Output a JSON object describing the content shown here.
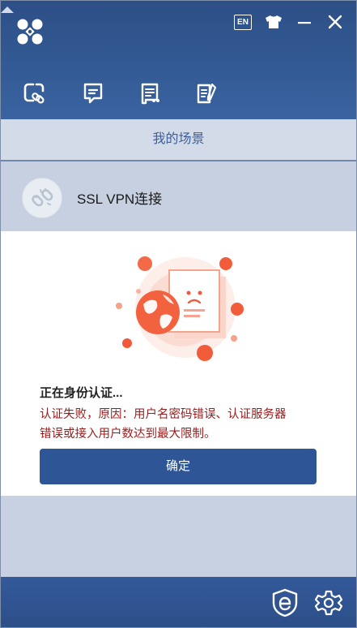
{
  "colors": {
    "header": "#2d4f86",
    "accent": "#2e5596",
    "error": "#9a1c1c",
    "tab_text": "#3e5f98"
  },
  "header": {
    "icons": [
      "app-logo-icon",
      "language-en-icon",
      "skin-shirt-icon",
      "minimize-icon",
      "close-icon"
    ],
    "language_badge": "EN"
  },
  "nav": {
    "tabs": [
      {
        "id": "scenes",
        "icon": "link-scene-icon",
        "active": true
      },
      {
        "id": "messages",
        "icon": "message-icon",
        "active": false
      },
      {
        "id": "logs",
        "icon": "log-list-icon",
        "active": false
      },
      {
        "id": "notes",
        "icon": "notes-icon",
        "active": false
      }
    ]
  },
  "section": {
    "title": "我的场景"
  },
  "scene": {
    "label": "SSL VPN连接"
  },
  "dialog": {
    "status": "正在身份认证...",
    "error_line1": "认证失败，原因：用户名密码错误、认证服务器",
    "error_line2": "错误或接入用户数达到最大限制。",
    "ok_label": "确定"
  },
  "footer": {
    "icons": [
      "shield-e-icon",
      "settings-gear-icon"
    ]
  }
}
